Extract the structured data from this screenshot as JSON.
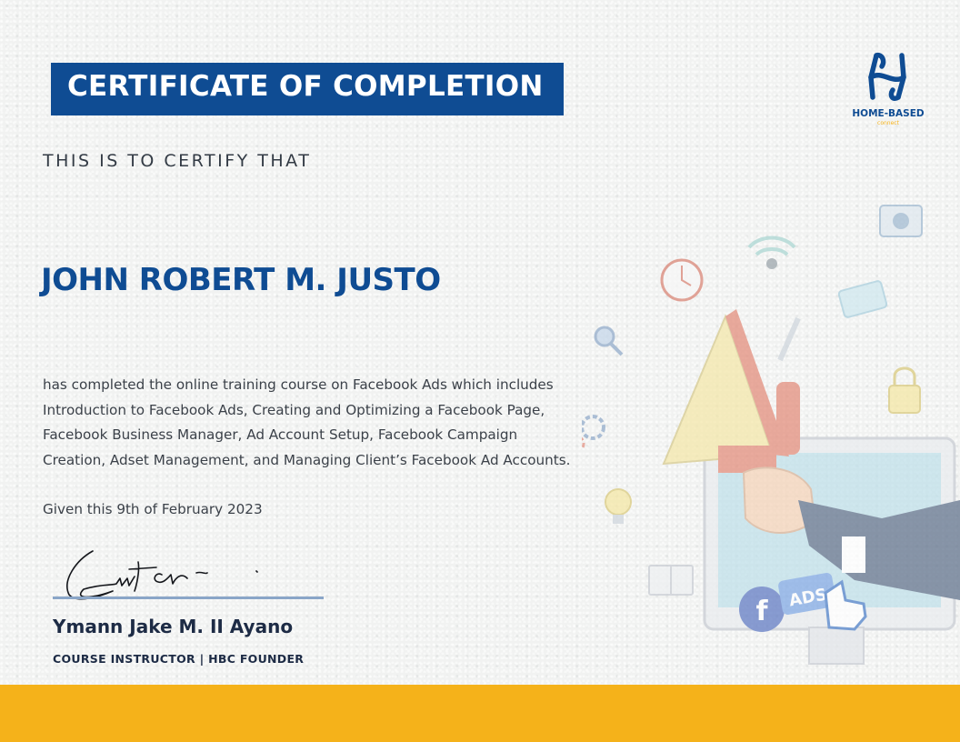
{
  "certificate": {
    "title": "CERTIFICATE OF COMPLETION",
    "certify_text": "THIS IS TO CERTIFY THAT",
    "recipient_name": "JOHN ROBERT M. JUSTO",
    "description_lines": [
      "has completed the online training course on Facebook Ads which includes",
      "Introduction to Facebook Ads, Creating and Optimizing a Facebook Page,",
      "Facebook Business Manager, Ad Account Setup, Facebook Campaign",
      "Creation, Adset Management, and Managing Client’s Facebook Ad Accounts."
    ],
    "given_date": "Given this 9th of February 2023"
  },
  "signatory": {
    "name": "Ymann Jake M. II Ayano",
    "role": "COURSE INSTRUCTOR | HBC FOUNDER"
  },
  "logo": {
    "name": "HOME-BASED",
    "sub": "connect"
  },
  "illustration": {
    "ads_badge": "ADS",
    "facebook_letter": "f"
  },
  "colors": {
    "primary_blue": "#0f4c93",
    "accent_yellow": "#f5b21a",
    "text_dark": "#1d2b45",
    "background": "#f1f2f1"
  },
  "icons": [
    "megaphone-icon",
    "clock-icon",
    "wifi-icon",
    "camera-icon",
    "lock-icon",
    "gear-icon",
    "lightbulb-icon",
    "magnifier-icon",
    "pen-icon",
    "book-icon",
    "monitor-icon",
    "facebook-icon",
    "hand-cursor-icon"
  ]
}
